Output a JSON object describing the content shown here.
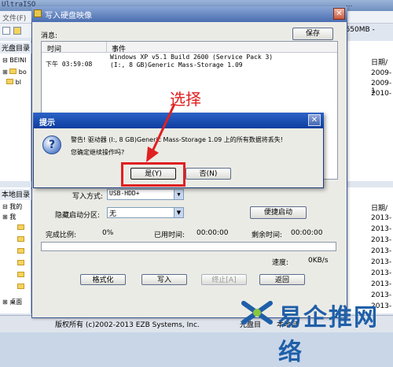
{
  "background_app": {
    "title": "UltraISO",
    "title_tail": "...",
    "menu_file": "文件(F)",
    "size_label": "of 650MB -",
    "left_pane_header": "光盘目录",
    "tree_beinet": "BEINI",
    "tree_bo": "bo",
    "tree_bl": "bl",
    "local_dir_header": "本地目录",
    "tree_mine": "我的",
    "tree_my": "我",
    "tree_desktop": "桌面",
    "date_header": "日期/",
    "dates_top": [
      "2009-",
      "2009-1",
      "2010-"
    ],
    "dates_bottom": [
      "2013-",
      "2013-",
      "2013-",
      "2013-",
      "2013-",
      "2013-",
      "2013-",
      "2013-",
      "2013-"
    ],
    "copyright": "版权所有 (c)2002-2013 EZB Systems, Inc.",
    "status_right": "光盘目",
    "status_right2": "本地目"
  },
  "write_dialog": {
    "title": "写入硬盘映像",
    "close_label": "✕",
    "message_label": "消息:",
    "save_label": "保存",
    "columns": [
      "时间",
      "事件"
    ],
    "log": {
      "time": "下午 03:59:08",
      "event_line1": "Windows XP v5.1 Build 2600 (Service Pack 3)",
      "event_line2": "(I:, 8 GB)Generic Mass-Storage      1.09"
    },
    "write_mode_label": "写入方式:",
    "write_mode_value": "USB-HDD+",
    "hide_partition_label": "隐藏启动分区:",
    "hide_partition_value": "无",
    "convenient_boot_label": "便捷启动",
    "complete_label": "完成比例:",
    "complete_value": "0%",
    "elapsed_label": "已用时间:",
    "elapsed_value": "00:00:00",
    "remaining_label": "剩余时间:",
    "remaining_value": "00:00:00",
    "progress": 0,
    "speed_label": "速度:",
    "speed_value": "0KB/s",
    "buttons": {
      "format": "格式化",
      "write": "写入",
      "terminate": "终止[A]",
      "return": "返回"
    }
  },
  "prompt": {
    "title": "提示",
    "close_label": "✕",
    "icon": "question-icon",
    "icon_glyph": "?",
    "message1": "警告! 驱动器 (I:, 8 GB)Generic Mass-Storage     1.09 上的所有数据将丢失!",
    "message2": "您确定继续操作吗?",
    "yes_label": "是(Y)",
    "no_label": "否(N)"
  },
  "annotation": {
    "text": "选择",
    "color": "#e02020"
  },
  "watermark": {
    "text": "易企推网络"
  }
}
